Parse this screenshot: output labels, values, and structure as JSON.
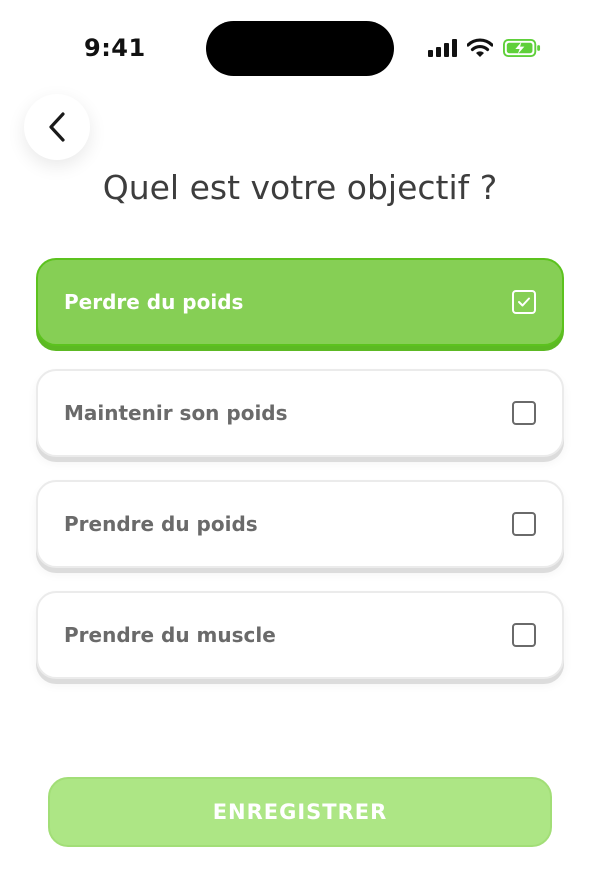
{
  "status_bar": {
    "time": "9:41",
    "icons": [
      "signal-icon",
      "wifi-icon",
      "battery-charging-icon"
    ],
    "battery_color": "#5fd03a"
  },
  "header": {
    "back_icon": "chevron-left-icon",
    "title": "Quel est votre objectif ?"
  },
  "options": [
    {
      "label": "Perdre du poids",
      "selected": true
    },
    {
      "label": "Maintenir son poids",
      "selected": false
    },
    {
      "label": "Prendre du poids",
      "selected": false
    },
    {
      "label": "Prendre du muscle",
      "selected": false
    }
  ],
  "footer": {
    "save_label": "ENREGISTRER"
  },
  "colors": {
    "accent": "#86cf55",
    "accent_border": "#5cc21e",
    "button_disabled": "#ade685",
    "text_primary": "#3d3d3d",
    "text_secondary": "#6a6a6a"
  }
}
